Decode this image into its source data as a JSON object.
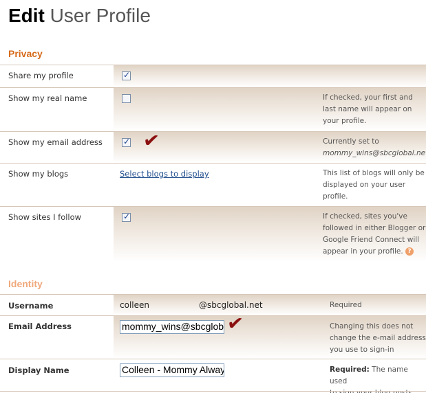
{
  "header": {
    "title_bold": "Edit",
    "title_rest": "User Profile"
  },
  "privacy": {
    "heading": "Privacy",
    "rows": [
      {
        "label": "Share my profile",
        "checked": true,
        "note": []
      },
      {
        "label": "Show my real name",
        "checked": false,
        "note": [
          "If checked, your first and",
          "last name will appear on",
          "your profile."
        ]
      },
      {
        "label": "Show my email address",
        "checked": true,
        "note": [
          "Currently set to",
          "mommy_wins@sbcglobal.net"
        ]
      },
      {
        "label": "Show my blogs",
        "link": "Select blogs to display",
        "note": [
          "This list of blogs will only be",
          "displayed on your user",
          "profile."
        ]
      },
      {
        "label": "Show sites I follow",
        "checked": true,
        "note": [
          "If checked, sites you've",
          "followed in either Blogger or",
          "Google Friend Connect will",
          "appear in your profile."
        ]
      }
    ]
  },
  "identity": {
    "heading": "Identity",
    "username": {
      "label": "Username",
      "value_left": "colleen",
      "value_right": "@sbcglobal.net",
      "note": "Required"
    },
    "email": {
      "label": "Email Address",
      "value": "mommy_wins@sbcglobal.net",
      "note": [
        "Changing this does not",
        "change the e-mail address",
        "you use to sign-in"
      ]
    },
    "display_name": {
      "label": "Display Name",
      "value": "Colleen - Mommy Always Wins",
      "note_bold": "Required:",
      "note": [
        " The name used",
        "to sign your blog posts."
      ]
    }
  },
  "icons": {
    "help": "question-mark-icon",
    "annotation": "red-checkmark-annotation"
  },
  "colors": {
    "accent": "#d56a19",
    "identity_heading": "#f0a87a",
    "link": "#1f4d8c"
  }
}
